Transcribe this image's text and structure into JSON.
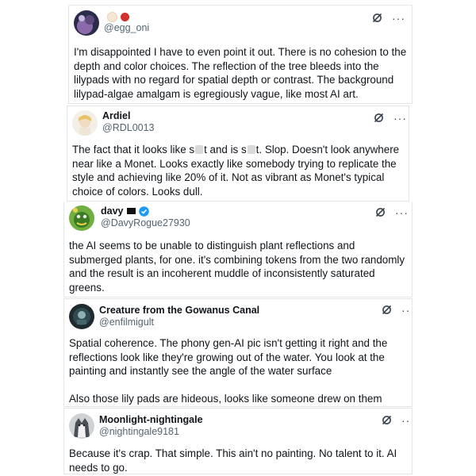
{
  "replies": [
    {
      "name": "",
      "handle": "@egg_oni",
      "text": "I'm disappointed I have to even point it out. There is no cohesion to the depth and color choices. The reflection of the tree bleeds into the lilypads with no regard for spatial depth or contrast. The background lilypad-algae amalgam is egregiously vague, like most AI art."
    },
    {
      "name": "Ardiel",
      "handle": "@RDL0013",
      "text_a": "The fact that it looks like s",
      "text_b": "t and is s",
      "text_c": "t. Slop. Doesn't look anywhere near like a Monet. Looks exactly like somebody trying to replicate the style and achieving like 20% of it. Not as vibrant as Monet's typical choice of colors. Looks dull."
    },
    {
      "name": "davy",
      "handle": "@DavyRogue27930",
      "text": "the AI seems to be unable to distinguish plant reflections and submerged plants, for one. it's combining tokens from the two randomly and the result is an incoherent muddle of inconsistently saturated greens."
    },
    {
      "name": "Creature from the Gowanus Canal",
      "handle": "@enfilmigult",
      "text": "Spatial coherence. The phony gen-AI pic isn't getting it right and the reflections look like they're growing out of the water. You look at the painting and instantly see the angle of the water surface",
      "text2": "Also those lily pads are hideous, looks like someone drew on them"
    },
    {
      "name": "Moonlight-nightingale",
      "handle": "@nightingale9181",
      "text": "Because it's crap. That simple. This ain't no painting. No talent to it. AI needs to go."
    }
  ],
  "icons": {
    "grok": "grok-slash-icon",
    "more": "more-dots-icon",
    "verified": "verified-check-icon",
    "flag": "black-flag-icon"
  },
  "more_label": "···",
  "colors": {
    "verified": "#1d9bf0",
    "handle": "#536471",
    "border": "#e3e6e8"
  }
}
